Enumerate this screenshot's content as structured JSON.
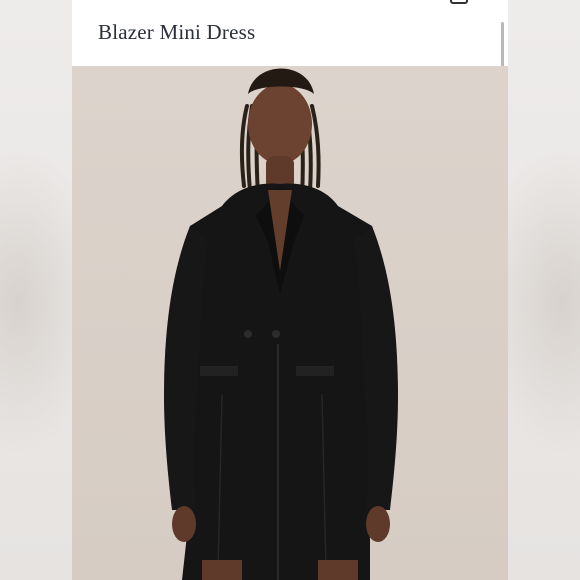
{
  "product": {
    "title": "Blazer Mini Dress"
  },
  "icons": {
    "top_right": "bag-icon"
  },
  "colors": {
    "photo_background": "#d9d0c8",
    "garment": "#151515",
    "title_text": "#2a2f3a"
  }
}
